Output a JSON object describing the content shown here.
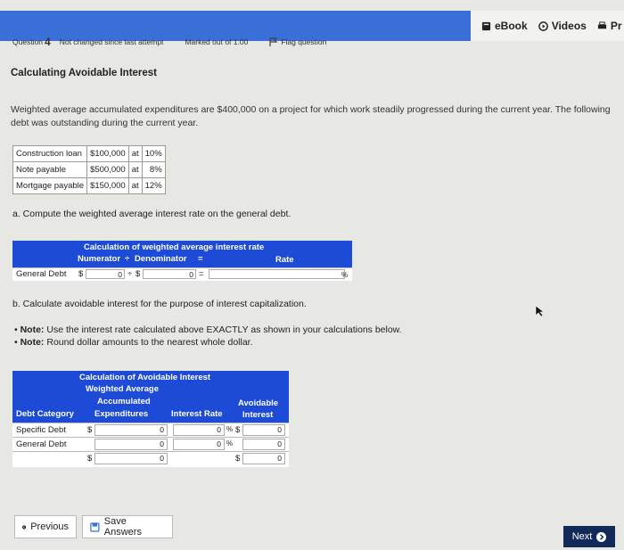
{
  "toolbar": {
    "ebook": "eBook",
    "videos": "Videos",
    "print": "Pr"
  },
  "question_bar": {
    "label": "Question",
    "number": "4",
    "status": "Not changed since last attempt",
    "marked": "Marked out of 1.00",
    "flag": "Flag question"
  },
  "title": "Calculating Avoidable Interest",
  "description": "Weighted average accumulated expenditures are $400,000 on a project for which work steadily progressed during the current year. The following debt was outstanding during the current year.",
  "debts": [
    {
      "name": "Construction loan",
      "amount": "$100,000",
      "at": "at",
      "rate": "10%"
    },
    {
      "name": "Note payable",
      "amount": "$500,000",
      "at": "at",
      "rate": "8%"
    },
    {
      "name": "Mortgage payable",
      "amount": "$150,000",
      "at": "at",
      "rate": "12%"
    }
  ],
  "part_a": "a. Compute the weighted average interest rate on the general debt.",
  "calc_rate": {
    "title": "Calculation of weighted average interest rate",
    "numerator": "Numerator",
    "div": "÷",
    "denominator": "Denominator",
    "eq": "=",
    "rate": "Rate",
    "row_label": "General Debt",
    "dollar": "$",
    "num_value": "0",
    "den_value": "0",
    "pct": "%"
  },
  "part_b": "b. Calculate avoidable interest for the purpose of interest capitalization.",
  "notes": [
    {
      "bold": "Note:",
      "text": " Use the interest rate calculated above EXACTLY as shown in your calculations below."
    },
    {
      "bold": "Note:",
      "text": " Round dollar amounts to the nearest whole dollar."
    }
  ],
  "avoidable": {
    "title": "Calculation of Avoidable Interest",
    "h_wa": "Weighted Average",
    "h_acc": "Accumulated",
    "h_exp": "Expenditures",
    "h_cat": "Debt Category",
    "h_rate": "Interest Rate",
    "h_avoid1": "Avoidable",
    "h_avoid2": "Interest",
    "dollar": "$",
    "pct": "%",
    "rows": [
      {
        "category": "Specific Debt",
        "expenditures": "0",
        "rate": "0",
        "interest": "0"
      },
      {
        "category": "General Debt",
        "expenditures": "0",
        "rate": "0",
        "interest": "0"
      }
    ],
    "total_expenditures": "0",
    "total_interest": "0"
  },
  "buttons": {
    "previous": "Previous",
    "save": "Save Answers",
    "next": "Next"
  }
}
